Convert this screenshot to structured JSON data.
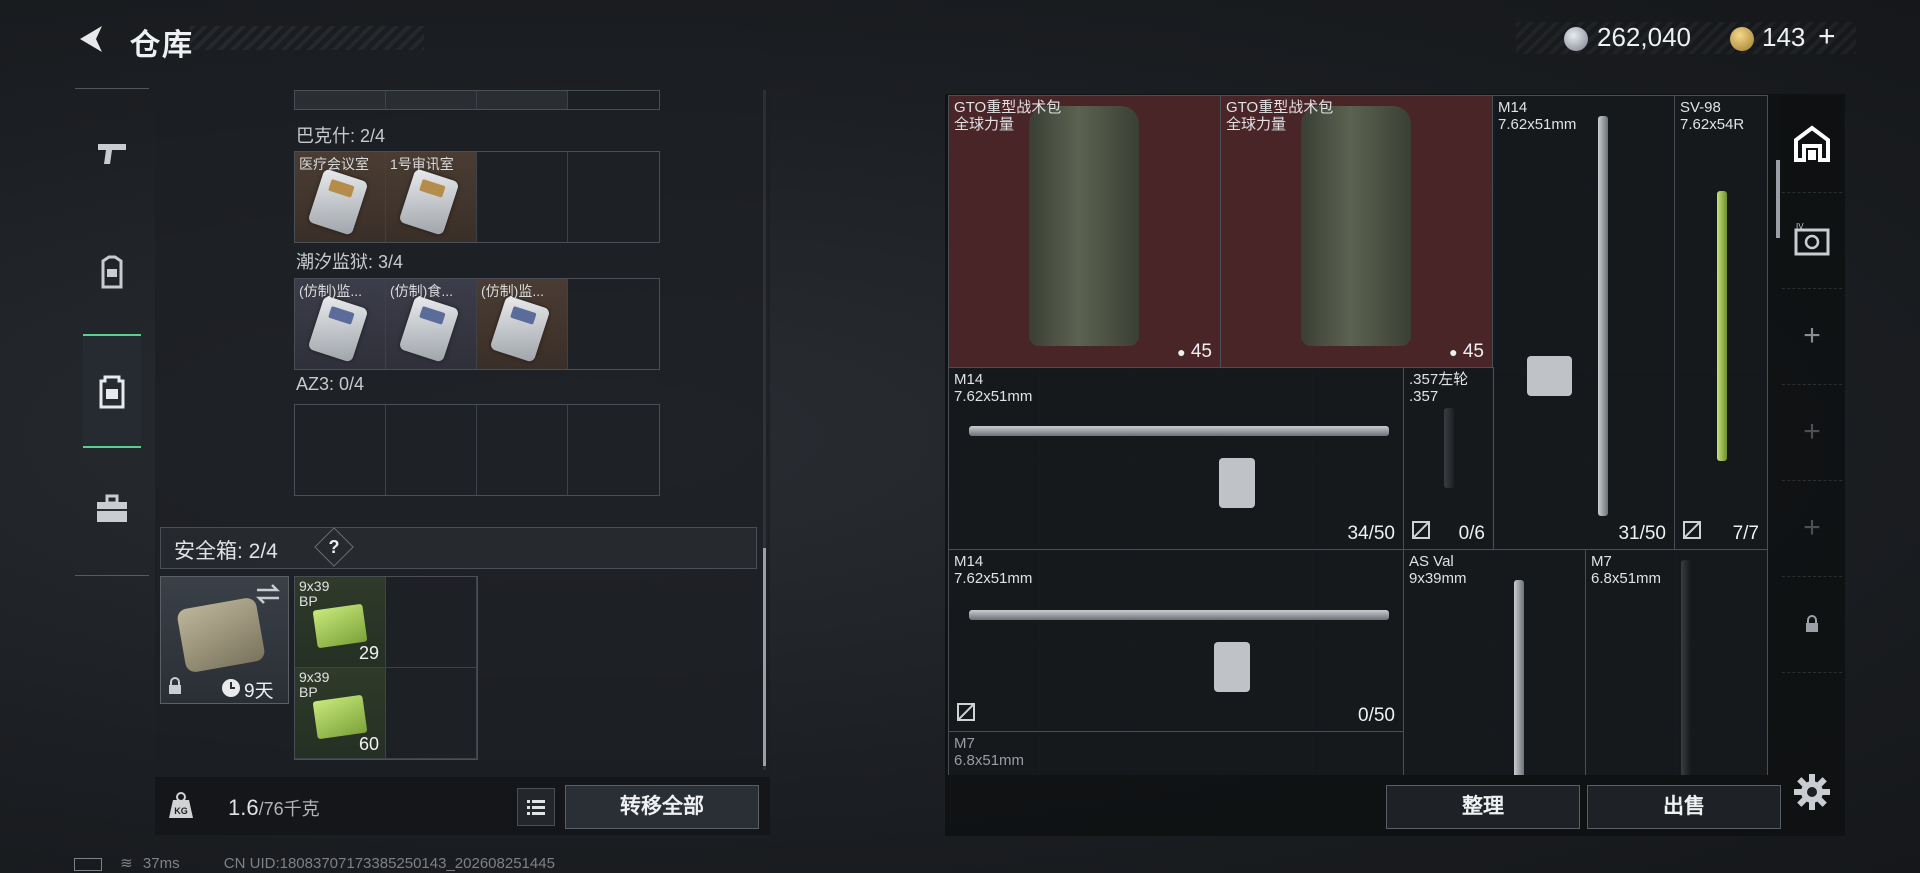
{
  "header": {
    "title": "仓库",
    "currency_primary": "262,040",
    "currency_secondary": "143",
    "add_symbol": "+"
  },
  "left_nav": {
    "items": [
      {
        "name": "weapons-tab",
        "icon": "gun-icon"
      },
      {
        "name": "equipment-tab",
        "icon": "armor-icon"
      },
      {
        "name": "storage-tab",
        "icon": "backpack-icon",
        "active": true
      },
      {
        "name": "briefcase-tab",
        "icon": "briefcase-icon"
      }
    ]
  },
  "storage": {
    "sections": [
      {
        "label": "巴克什: 2/4",
        "cells": [
          {
            "label": "医疗会议室",
            "tone": "warm"
          },
          {
            "label": "1号审讯室",
            "tone": "warm"
          },
          null,
          null
        ]
      },
      {
        "label": "潮汐监狱: 3/4",
        "cells": [
          {
            "label": "(仿制)监...",
            "tone": "cool"
          },
          {
            "label": "(仿制)食...",
            "tone": "cool"
          },
          {
            "label": "(仿制)监...",
            "tone": "warm"
          },
          null
        ]
      },
      {
        "label": "AZ3: 0/4",
        "cells": [
          null,
          null,
          null,
          null
        ]
      }
    ]
  },
  "safe_box": {
    "title": "安全箱: 2/4",
    "help": "?",
    "timer": "9天",
    "items": [
      {
        "name": "9x39\nBP",
        "count": "29"
      },
      {
        "name": "9x39\nBP",
        "count": "60"
      }
    ]
  },
  "weight": {
    "current": "1.6",
    "max": "/76千克"
  },
  "buttons": {
    "transfer_all": "转移全部",
    "sort": "整理",
    "sell": "出售"
  },
  "status_bar": {
    "ping": "37ms",
    "uid": "CN UID:18083707173385250143_202608251445"
  },
  "inventory": {
    "items": [
      {
        "id": "bag1",
        "name": "GTO重型战术包\n全球力量",
        "count": "45"
      },
      {
        "id": "bag2",
        "name": "GTO重型战术包\n全球力量",
        "count": "45"
      },
      {
        "id": "m14_v",
        "name": "M14\n7.62x51mm",
        "count": "31/50"
      },
      {
        "id": "sv98",
        "name": "SV-98\n7.62x54R",
        "count": "7/7"
      },
      {
        "id": "m14_h1",
        "name": "M14\n7.62x51mm",
        "count": "34/50"
      },
      {
        "id": "rev357",
        "name": ".357左轮\n.357",
        "count": "0/6"
      },
      {
        "id": "m14_h2",
        "name": "M14\n7.62x51mm",
        "count": "0/50"
      },
      {
        "id": "asval",
        "name": "AS Val\n9x39mm",
        "count": ""
      },
      {
        "id": "m7_v",
        "name": "M7\n6.8x51mm",
        "count": ""
      },
      {
        "id": "m7_h",
        "name": "M7\n6.8x51mm",
        "count": ""
      }
    ]
  },
  "colors": {
    "accent_green": "#5ad08f",
    "bag_highlight": "#4a2528"
  }
}
